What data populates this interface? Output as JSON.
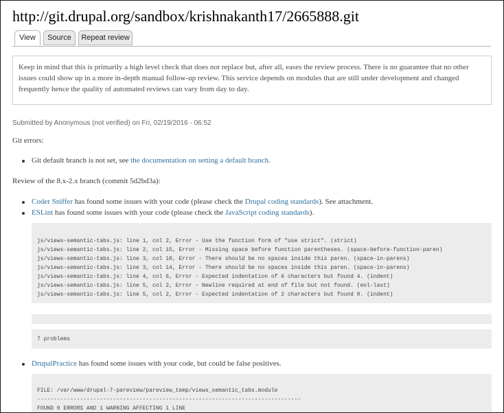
{
  "page": {
    "title": "http://git.drupal.org/sandbox/krishnakanth17/2665888.git"
  },
  "tabs": [
    {
      "label": "View",
      "active": true
    },
    {
      "label": "Source",
      "active": false
    },
    {
      "label": "Repeat review",
      "active": false
    }
  ],
  "notice": {
    "text": "Keep in mind that this is primarily a high level check that does not replace but, after all, eases the review process. There is no guarantee that no other issues could show up in a more in-depth manual follow-up review. This service depends on modules that are still under development and changed frequently hence the quality of automated reviews can vary from day to day."
  },
  "submitted": "Submitted by Anonymous (not verified) on Fri, 02/19/2016 - 06:52",
  "git_errors": {
    "heading": "Git errors:",
    "item_prefix": "Git default branch is not set, see ",
    "item_link": "the documentation on setting a default branch."
  },
  "review": {
    "heading": "Review of the 8.x-2.x branch (commit 5d2bd3a):",
    "coder": {
      "link": "Coder Sniffer",
      "middle": " has found some issues with your code (please check the ",
      "standards_link": "Drupal coding standards",
      "suffix": "). See attachment."
    },
    "eslint": {
      "link": "ESLint",
      "middle": " has found some issues with your code (please check the ",
      "standards_link": "JavaScript coding standards",
      "suffix": ")."
    },
    "eslint_output": [
      "js/views-semantic-tabs.js: line 1, col 2, Error - Use the function form of \"use strict\". (strict)",
      "js/views-semantic-tabs.js: line 2, col 15, Error - Missing space before function parentheses. (space-before-function-paren)",
      "js/views-semantic-tabs.js: line 3, col 10, Error - There should be no spaces inside this paren. (space-in-parens)",
      "js/views-semantic-tabs.js: line 3, col 14, Error - There should be no spaces inside this paren. (space-in-parens)",
      "js/views-semantic-tabs.js: line 4, col 6, Error - Expected indentation of 6 characters but found 4. (indent)",
      "js/views-semantic-tabs.js: line 5, col 2, Error - Newline required at end of file but not found. (eol-last)",
      "js/views-semantic-tabs.js: line 5, col 2, Error - Expected indentation of 2 characters but found 0. (indent)"
    ],
    "problems": "7 problems",
    "drupalpractice": {
      "link": "DrupalPractice",
      "suffix": " has found some issues with your code, but could be false positives."
    },
    "dp_output": [
      "FILE: /var/www/drupal-7-pareview/pareview_temp/views_semantic_tabs.module",
      "--------------------------------------------------------------------------------",
      "FOUND 0 ERRORS AND 1 WARNING AFFECTING 1 LINE"
    ]
  }
}
